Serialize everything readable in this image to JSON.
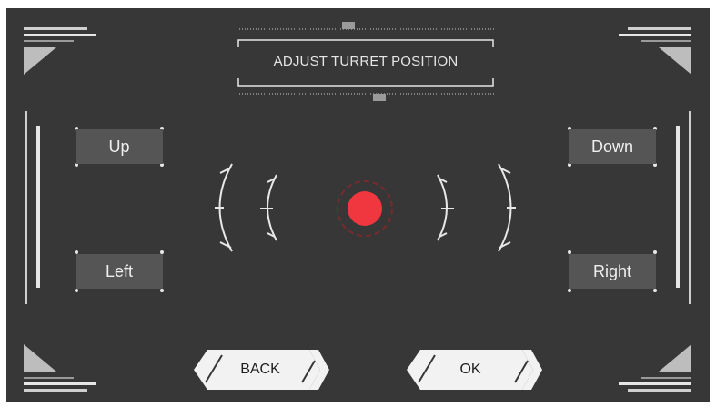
{
  "title": "ADJUST TURRET POSITION",
  "buttons": {
    "up": "Up",
    "down": "Down",
    "left": "Left",
    "right": "Right",
    "back": "BACK",
    "ok": "OK"
  },
  "colors": {
    "panel": "#373737",
    "button_fill": "#555555",
    "target": "#f0363f",
    "frame": "#e8e8e8",
    "action_button": "#f2f2f2"
  },
  "icons": {
    "target": "red-target-dot",
    "reticle": "bracket-arcs"
  }
}
